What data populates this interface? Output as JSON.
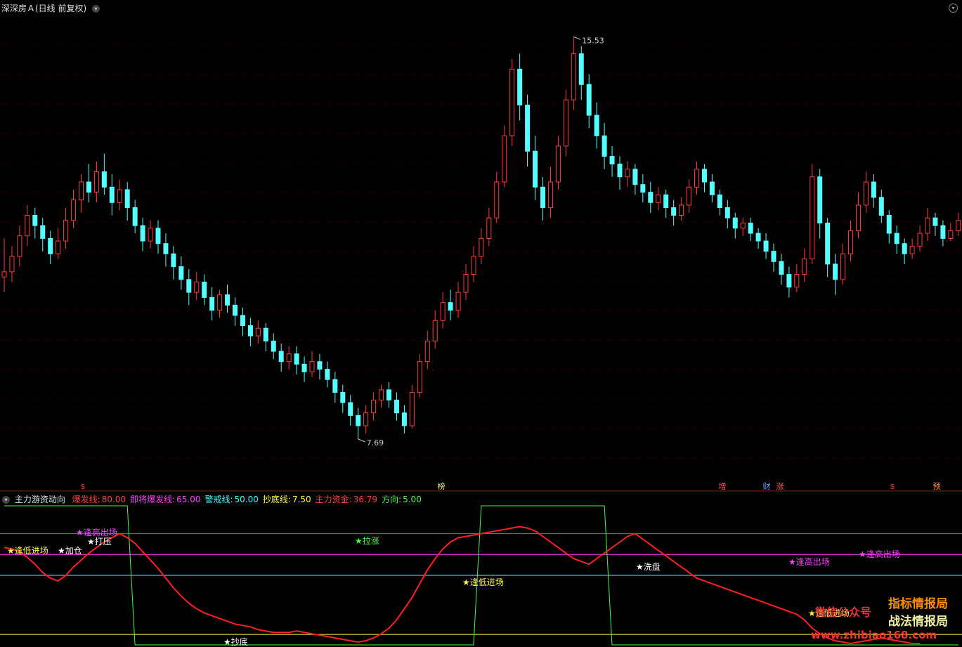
{
  "main_header": {
    "title": "深深房Ａ(日线 前复权)"
  },
  "indicator_header": {
    "name": "主力游资动向",
    "params": [
      {
        "label": "爆发线:",
        "value": "80.00",
        "color": "#ff4040"
      },
      {
        "label": "即将爆发线:",
        "value": "65.00",
        "color": "#ff40ff"
      },
      {
        "label": "警戒线:",
        "value": "50.00",
        "color": "#40ffff"
      },
      {
        "label": "抄底线:",
        "value": "7.50",
        "color": "#ffff40"
      },
      {
        "label": "主力资金:",
        "value": "36.79",
        "color": "#ff4040"
      },
      {
        "label": "方向:",
        "value": "5.00",
        "color": "#40ff40"
      }
    ]
  },
  "event_markers": [
    {
      "text": "$",
      "color": "#ff3030"
    },
    {
      "text": "榜",
      "color": "#f0e68c"
    },
    {
      "text": "增",
      "color": "#ff6060"
    },
    {
      "text": "财",
      "color": "#6aa0ff"
    },
    {
      "text": "涨",
      "color": "#ff6060"
    },
    {
      "text": "$",
      "color": "#ff3030"
    },
    {
      "text": "预",
      "color": "#ffa040"
    }
  ],
  "watermark": {
    "line1": "指标情报局",
    "line2": "战法情报局",
    "line3": "微信公众号",
    "url": "www.zhibiao168.com"
  },
  "chart_data": [
    {
      "type": "candlestick",
      "colors": {
        "up": "#ff3b3b",
        "down": "#54ffff"
      },
      "annotations": [
        {
          "text": "15.53"
        },
        {
          "text": "7.69"
        }
      ],
      "ylim": [
        6.8,
        16.0
      ],
      "candles": [
        [
          0,
          10.85,
          10.95,
          11.6,
          10.55
        ],
        [
          1,
          10.95,
          11.25,
          11.45,
          10.75
        ],
        [
          2,
          11.25,
          11.65,
          11.85,
          11.05
        ],
        [
          3,
          11.65,
          12.05,
          12.25,
          11.45
        ],
        [
          4,
          12.05,
          11.85,
          12.2,
          11.6
        ],
        [
          5,
          11.85,
          11.6,
          12.0,
          11.35
        ],
        [
          6,
          11.6,
          11.3,
          11.75,
          11.1
        ],
        [
          7,
          11.3,
          11.55,
          11.8,
          11.2
        ],
        [
          8,
          11.55,
          11.95,
          12.2,
          11.4
        ],
        [
          9,
          11.95,
          12.35,
          12.55,
          11.8
        ],
        [
          10,
          12.35,
          12.7,
          12.85,
          12.1
        ],
        [
          11,
          12.7,
          12.5,
          13.05,
          12.3
        ],
        [
          12,
          12.5,
          12.9,
          13.1,
          12.3
        ],
        [
          13,
          12.9,
          12.6,
          13.25,
          12.45
        ],
        [
          14,
          12.6,
          12.3,
          12.85,
          12.05
        ],
        [
          15,
          12.3,
          12.55,
          12.75,
          12.15
        ],
        [
          16,
          12.55,
          12.2,
          12.7,
          11.95
        ],
        [
          17,
          12.2,
          11.85,
          12.35,
          11.7
        ],
        [
          18,
          11.85,
          11.55,
          12.0,
          11.35
        ],
        [
          19,
          11.55,
          11.8,
          11.95,
          11.4
        ],
        [
          20,
          11.8,
          11.5,
          11.95,
          11.3
        ],
        [
          21,
          11.5,
          11.3,
          11.7,
          11.05
        ],
        [
          22,
          11.3,
          11.05,
          11.45,
          10.8
        ],
        [
          23,
          11.05,
          10.8,
          11.25,
          10.6
        ],
        [
          24,
          10.8,
          10.55,
          11.0,
          10.3
        ],
        [
          25,
          10.55,
          10.75,
          10.95,
          10.4
        ],
        [
          26,
          10.75,
          10.45,
          10.9,
          10.3
        ],
        [
          27,
          10.45,
          10.2,
          10.65,
          10.0
        ],
        [
          28,
          10.2,
          10.5,
          10.6,
          10.05
        ],
        [
          29,
          10.5,
          10.3,
          10.7,
          10.15
        ],
        [
          30,
          10.3,
          10.1,
          10.45,
          9.9
        ],
        [
          31,
          10.1,
          9.9,
          10.25,
          9.7
        ],
        [
          32,
          9.9,
          9.7,
          10.05,
          9.5
        ],
        [
          33,
          9.7,
          9.85,
          10.0,
          9.55
        ],
        [
          34,
          9.85,
          9.6,
          9.95,
          9.4
        ],
        [
          35,
          9.6,
          9.4,
          9.75,
          9.25
        ],
        [
          36,
          9.4,
          9.2,
          9.55,
          9.0
        ],
        [
          37,
          9.2,
          9.35,
          9.5,
          9.05
        ],
        [
          38,
          9.35,
          9.15,
          9.5,
          8.95
        ],
        [
          39,
          9.15,
          9.0,
          9.3,
          8.8
        ],
        [
          40,
          9.0,
          9.2,
          9.4,
          8.9
        ],
        [
          41,
          9.2,
          9.05,
          9.35,
          8.85
        ],
        [
          42,
          9.05,
          8.85,
          9.2,
          8.7
        ],
        [
          43,
          8.85,
          8.6,
          9.0,
          8.4
        ],
        [
          44,
          8.6,
          8.4,
          8.75,
          8.2
        ],
        [
          45,
          8.4,
          8.15,
          8.55,
          7.95
        ],
        [
          46,
          8.15,
          7.95,
          8.3,
          7.69
        ],
        [
          47,
          7.95,
          8.2,
          8.35,
          7.8
        ],
        [
          48,
          8.2,
          8.45,
          8.6,
          8.05
        ],
        [
          49,
          8.45,
          8.65,
          8.75,
          8.3
        ],
        [
          50,
          8.65,
          8.45,
          8.8,
          8.3
        ],
        [
          51,
          8.45,
          8.2,
          8.6,
          8.05
        ],
        [
          52,
          8.2,
          7.95,
          8.35,
          7.8
        ],
        [
          53,
          7.95,
          8.6,
          8.75,
          7.9
        ],
        [
          54,
          8.6,
          9.2,
          9.35,
          8.5
        ],
        [
          55,
          9.2,
          9.6,
          9.8,
          9.05
        ],
        [
          56,
          9.6,
          10.0,
          10.2,
          9.45
        ],
        [
          57,
          10.0,
          10.35,
          10.55,
          9.85
        ],
        [
          58,
          10.35,
          10.2,
          10.6,
          10.0
        ],
        [
          59,
          10.2,
          10.55,
          10.75,
          10.05
        ],
        [
          60,
          10.55,
          10.9,
          11.1,
          10.4
        ],
        [
          61,
          10.9,
          11.25,
          11.45,
          10.75
        ],
        [
          62,
          11.25,
          11.6,
          11.8,
          11.1
        ],
        [
          63,
          11.6,
          12.0,
          12.2,
          11.45
        ],
        [
          64,
          12.0,
          12.7,
          12.9,
          11.9
        ],
        [
          65,
          12.7,
          13.6,
          13.8,
          12.6
        ],
        [
          66,
          13.6,
          14.9,
          15.1,
          13.4
        ],
        [
          67,
          14.9,
          14.2,
          15.2,
          13.9
        ],
        [
          68,
          14.2,
          13.3,
          14.4,
          13.0
        ],
        [
          69,
          13.3,
          12.6,
          13.6,
          12.35
        ],
        [
          70,
          12.6,
          12.2,
          12.8,
          11.95
        ],
        [
          71,
          12.2,
          12.7,
          13.0,
          12.0
        ],
        [
          72,
          12.7,
          13.4,
          13.6,
          12.55
        ],
        [
          73,
          13.4,
          14.3,
          14.5,
          13.2
        ],
        [
          74,
          14.3,
          15.2,
          15.53,
          14.1
        ],
        [
          75,
          15.2,
          14.6,
          15.35,
          14.3
        ],
        [
          76,
          14.6,
          14.0,
          14.8,
          13.75
        ],
        [
          77,
          14.0,
          13.6,
          14.25,
          13.35
        ],
        [
          78,
          13.6,
          13.2,
          13.85,
          12.95
        ],
        [
          79,
          13.2,
          13.05,
          13.4,
          12.8
        ],
        [
          80,
          13.05,
          12.8,
          13.2,
          12.55
        ],
        [
          81,
          12.8,
          12.95,
          13.1,
          12.6
        ],
        [
          82,
          12.95,
          12.65,
          13.05,
          12.45
        ],
        [
          83,
          12.65,
          12.5,
          12.85,
          12.3
        ],
        [
          84,
          12.5,
          12.3,
          12.7,
          12.1
        ],
        [
          85,
          12.3,
          12.45,
          12.6,
          12.15
        ],
        [
          86,
          12.45,
          12.2,
          12.55,
          12.0
        ],
        [
          87,
          12.2,
          12.05,
          12.35,
          11.85
        ],
        [
          88,
          12.05,
          12.25,
          12.4,
          11.95
        ],
        [
          89,
          12.25,
          12.6,
          12.75,
          12.1
        ],
        [
          90,
          12.6,
          12.95,
          13.1,
          12.45
        ],
        [
          91,
          12.95,
          12.7,
          13.05,
          12.5
        ],
        [
          92,
          12.7,
          12.45,
          12.85,
          12.3
        ],
        [
          93,
          12.45,
          12.2,
          12.55,
          12.05
        ],
        [
          94,
          12.2,
          12.0,
          12.35,
          11.8
        ],
        [
          95,
          12.0,
          11.8,
          12.1,
          11.6
        ],
        [
          96,
          11.8,
          11.9,
          12.0,
          11.65
        ],
        [
          97,
          11.9,
          11.7,
          12.0,
          11.55
        ],
        [
          98,
          11.7,
          11.55,
          11.8,
          11.4
        ],
        [
          99,
          11.55,
          11.35,
          11.7,
          11.2
        ],
        [
          100,
          11.35,
          11.15,
          11.5,
          10.95
        ],
        [
          101,
          11.15,
          10.9,
          11.3,
          10.7
        ],
        [
          102,
          10.9,
          10.65,
          11.05,
          10.45
        ],
        [
          103,
          10.65,
          10.9,
          11.1,
          10.55
        ],
        [
          104,
          10.9,
          11.2,
          11.4,
          10.75
        ],
        [
          105,
          11.2,
          12.8,
          13.05,
          11.1
        ],
        [
          106,
          12.8,
          11.9,
          12.95,
          11.6
        ],
        [
          107,
          11.9,
          11.1,
          12.0,
          10.85
        ],
        [
          108,
          11.1,
          10.8,
          11.3,
          10.5
        ],
        [
          109,
          10.8,
          11.3,
          11.5,
          10.7
        ],
        [
          110,
          11.3,
          11.75,
          11.95,
          11.15
        ],
        [
          111,
          11.75,
          12.25,
          12.5,
          11.6
        ],
        [
          112,
          12.25,
          12.7,
          12.9,
          12.1
        ],
        [
          113,
          12.7,
          12.4,
          12.85,
          12.2
        ],
        [
          114,
          12.4,
          12.05,
          12.55,
          11.9
        ],
        [
          115,
          12.05,
          11.7,
          12.15,
          11.5
        ],
        [
          116,
          11.7,
          11.5,
          11.85,
          11.3
        ],
        [
          117,
          11.5,
          11.3,
          11.6,
          11.1
        ],
        [
          118,
          11.3,
          11.45,
          11.6,
          11.2
        ],
        [
          119,
          11.45,
          11.7,
          11.85,
          11.35
        ],
        [
          120,
          11.7,
          12.0,
          12.2,
          11.55
        ],
        [
          121,
          12.0,
          11.85,
          12.1,
          11.65
        ],
        [
          122,
          11.85,
          11.6,
          11.95,
          11.45
        ],
        [
          123,
          11.6,
          11.75,
          11.9,
          11.55
        ],
        [
          124,
          11.75,
          11.95,
          12.1,
          11.65
        ]
      ]
    },
    {
      "type": "line",
      "series_style": {
        "money": "#ff2020",
        "direction": "#40ff40"
      },
      "ylim": [
        0,
        100
      ],
      "reference_lines": [
        {
          "value": 80,
          "color": "#ff4040"
        },
        {
          "value": 65,
          "color": "#ff40ff"
        },
        {
          "value": 50,
          "color": "#40ffff"
        },
        {
          "value": 7.5,
          "color": "#ffff40"
        }
      ],
      "money": [
        70,
        69,
        67,
        63,
        58,
        52,
        48,
        46,
        50,
        56,
        61,
        66,
        70,
        74,
        77,
        80,
        77,
        73,
        67,
        61,
        55,
        48,
        41,
        35,
        30,
        26,
        23,
        21,
        19,
        17,
        15,
        14,
        13,
        11,
        10,
        9,
        9,
        9,
        10,
        9,
        8,
        7,
        6,
        5,
        4,
        3,
        2,
        3,
        5,
        8,
        12,
        18,
        26,
        34,
        44,
        54,
        62,
        69,
        74,
        77,
        78,
        79,
        80,
        81,
        82,
        83,
        84,
        85,
        84,
        82,
        78,
        74,
        70,
        66,
        62,
        60,
        58,
        62,
        66,
        70,
        74,
        78,
        80,
        76,
        72,
        68,
        64,
        60,
        56,
        52,
        48,
        46,
        44,
        42,
        40,
        38,
        36,
        34,
        32,
        30,
        28,
        26,
        24,
        22,
        18,
        12,
        8,
        5,
        3,
        2,
        1,
        2,
        3,
        4,
        5,
        4,
        3,
        2,
        1,
        1
      ],
      "direction": [
        100,
        100,
        100,
        100,
        100,
        100,
        100,
        100,
        100,
        100,
        100,
        100,
        100,
        100,
        100,
        100,
        100,
        0,
        0,
        0,
        0,
        0,
        0,
        0,
        0,
        0,
        0,
        0,
        0,
        0,
        0,
        0,
        0,
        0,
        0,
        0,
        0,
        0,
        0,
        0,
        0,
        0,
        0,
        0,
        0,
        0,
        0,
        0,
        0,
        0,
        0,
        0,
        0,
        0,
        0,
        0,
        0,
        0,
        0,
        0,
        0,
        0,
        100,
        100,
        100,
        100,
        100,
        100,
        100,
        100,
        100,
        100,
        100,
        100,
        100,
        100,
        100,
        100,
        100,
        0,
        0,
        0,
        0,
        0,
        0,
        0,
        0,
        0,
        0,
        0,
        0,
        0,
        0,
        0,
        0,
        0,
        0,
        0,
        0,
        0,
        0,
        0,
        0,
        0,
        0,
        0,
        0,
        0,
        0,
        0,
        0,
        0,
        0,
        0,
        0,
        0,
        0,
        0,
        0,
        0,
        0,
        0,
        0,
        0,
        0
      ],
      "signals": [
        {
          "text": "加仓",
          "color": "#ffffff"
        },
        {
          "text": "打压",
          "color": "#ffffff"
        },
        {
          "text": "逢高出场",
          "color": "#ff40ff"
        },
        {
          "text": "逢低进场",
          "color": "#ffff40"
        },
        {
          "text": "拉涨",
          "color": "#40ff40"
        },
        {
          "text": "抄底",
          "color": "#ffffff"
        },
        {
          "text": "洗盘",
          "color": "#ffffff"
        },
        {
          "text": "逢低进场",
          "color": "#ffff40"
        },
        {
          "text": "逢高出场",
          "color": "#ff40ff"
        },
        {
          "text": "逢低进场",
          "color": "#ffff40"
        },
        {
          "text": "逢高出场",
          "color": "#ff40ff"
        }
      ]
    }
  ]
}
